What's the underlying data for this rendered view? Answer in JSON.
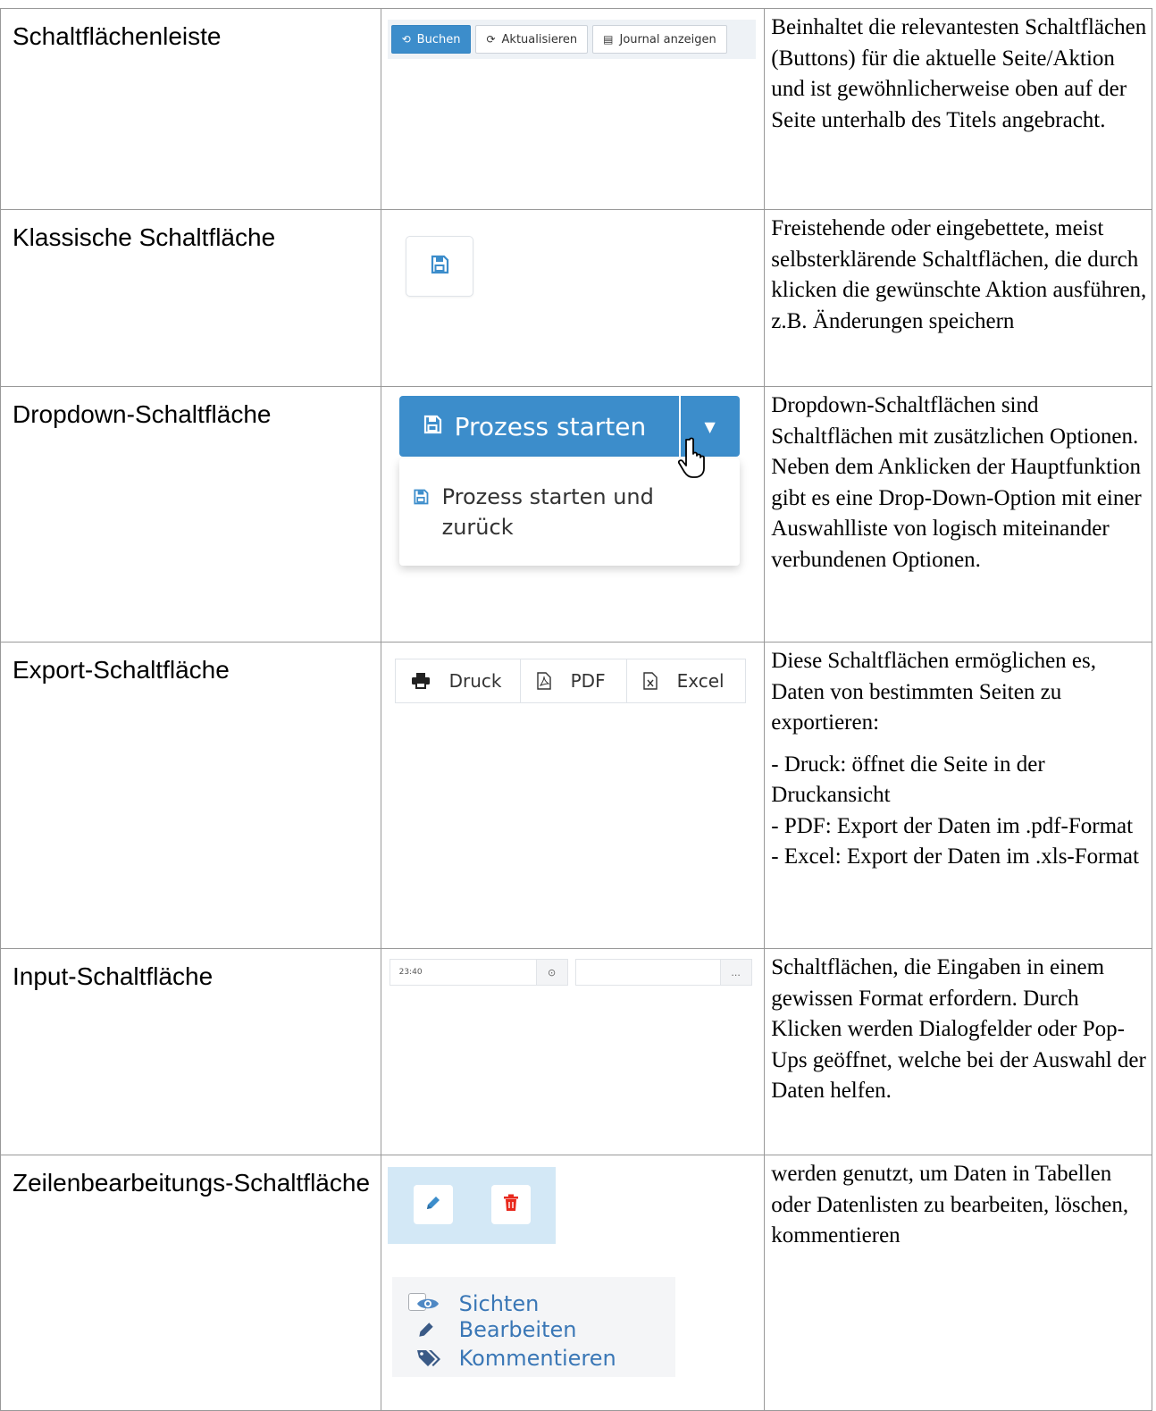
{
  "rows": [
    {
      "name": "Schaltflächenleiste",
      "desc": "Beinhaltet die relevantesten Schaltflächen (Buttons) für die aktuelle Seite/Aktion und ist gewöhnlicherweise oben auf der Seite unterhalb des Titels angebracht.",
      "toolbar": {
        "book": "Buchen",
        "refresh": "Aktualisieren",
        "journal": "Journal anzeigen"
      }
    },
    {
      "name": "Klassische Schaltfläche",
      "desc": "Freistehende oder eingebettete, meist selbsterklärende Schaltflächen, die durch klicken die gewünschte Aktion ausführen, z.B. Änderungen speichern"
    },
    {
      "name": "Dropdown-Schaltfläche",
      "desc": "Dropdown-Schaltflächen sind Schaltflächen mit zusätzlichen Optionen. Neben dem Anklicken der Hauptfunktion gibt es eine Drop-Down-Option mit einer Auswahlliste von logisch miteinander verbundenen Optionen.",
      "main": "Prozess starten",
      "option_line1": "Prozess starten und",
      "option_line2": "zurück"
    },
    {
      "name": "Export-Schaltfläche",
      "desc_intro": "Diese Schaltflächen ermöglichen es, Daten von bestimmten Seiten zu exportieren:",
      "desc_print": "- Druck: öffnet die Seite in der Druckansicht",
      "desc_pdf": "- PDF: Export der Daten im .pdf-Format",
      "desc_excel": "- Excel: Export der Daten im .xls-Format",
      "buttons": {
        "print": "Druck",
        "pdf": "PDF",
        "excel": "Excel"
      }
    },
    {
      "name": "Input-Schaltfläche",
      "desc": "Schaltflächen, die Eingaben in einem gewissen Format erfordern. Durch Klicken werden Dialogfelder oder Pop-Ups geöffnet, welche bei der Auswahl der Daten helfen.",
      "time_value": "23:40",
      "time_addon": "⊙",
      "lookup_addon": "..."
    },
    {
      "name": "Zeilenbearbeitungs-Schaltfläche",
      "desc": "werden genutzt, um Daten in Tabellen oder Datenlisten zu bearbeiten, löschen, kommentieren",
      "actions": {
        "view": "Sichten",
        "edit": "Bearbeiten",
        "comment": "Kommentieren"
      }
    }
  ],
  "colors": {
    "primary": "#3c8dcb",
    "link": "#3a77b6",
    "delete": "#e8291c",
    "edit_strip_bg": "#d3e8f6"
  }
}
